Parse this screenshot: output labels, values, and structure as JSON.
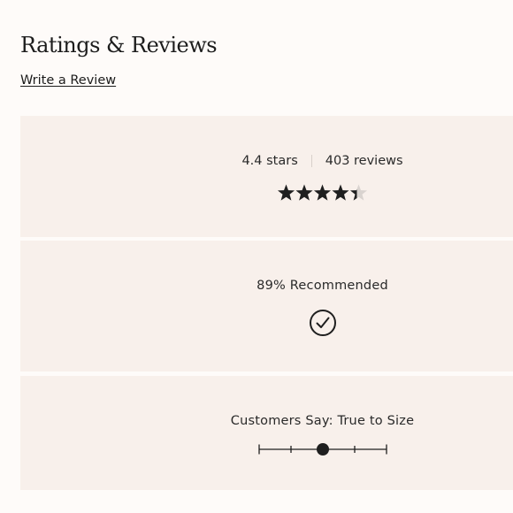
{
  "header": {
    "title": "Ratings & Reviews",
    "write_review_label": "Write a Review"
  },
  "rating": {
    "stars_text": "4.4 stars",
    "reviews_text": "403 reviews",
    "stars_value": 4.4,
    "stars_max": 5
  },
  "recommend": {
    "label": "89% Recommended",
    "icon": "check-circle-icon"
  },
  "fit": {
    "label": "Customers Say: True to Size",
    "scale_steps": 5,
    "selected_step": 3
  },
  "colors": {
    "background": "#fefbf9",
    "panel": "#f8f0eb",
    "ink": "#1f1f1f",
    "star_empty": "#d9d3cf"
  }
}
